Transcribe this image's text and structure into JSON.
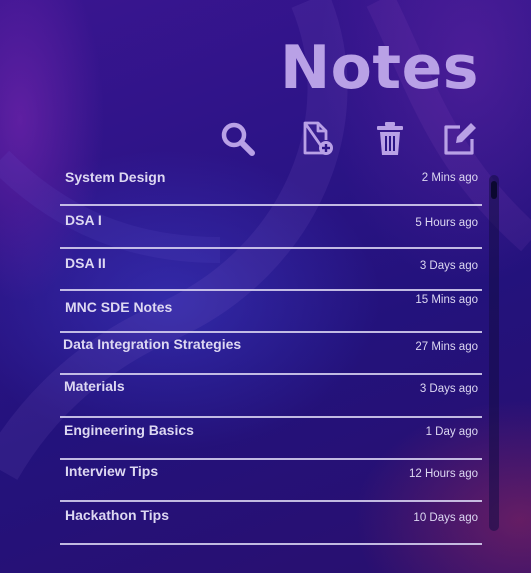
{
  "header": {
    "title": "Notes"
  },
  "toolbar": {
    "items": [
      {
        "icon": "search-icon",
        "action": "search"
      },
      {
        "icon": "new-file-icon",
        "action": "add"
      },
      {
        "icon": "trash-icon",
        "action": "delete"
      },
      {
        "icon": "edit-icon",
        "action": "edit"
      }
    ],
    "icon_color": "#b9a1e6"
  },
  "notes": [
    {
      "title": "System Design",
      "time": "2 Mins ago"
    },
    {
      "title": "DSA I",
      "time": "5 Hours ago"
    },
    {
      "title": "DSA II",
      "time": "3 Days ago"
    },
    {
      "title": "MNC SDE Notes",
      "time": "15 Mins ago"
    },
    {
      "title": "Data Integration Strategies",
      "time": "27 Mins ago"
    },
    {
      "title": "Materials",
      "time": "3 Days ago"
    },
    {
      "title": "Engineering Basics",
      "time": "1 Day ago"
    },
    {
      "title": "Interview Tips",
      "time": "12 Hours ago"
    },
    {
      "title": "Hackathon Tips",
      "time": "10 Days ago"
    }
  ],
  "colors": {
    "accent": "#b9a1e6",
    "text": "#ddd8f2",
    "background": "#2b1486"
  }
}
